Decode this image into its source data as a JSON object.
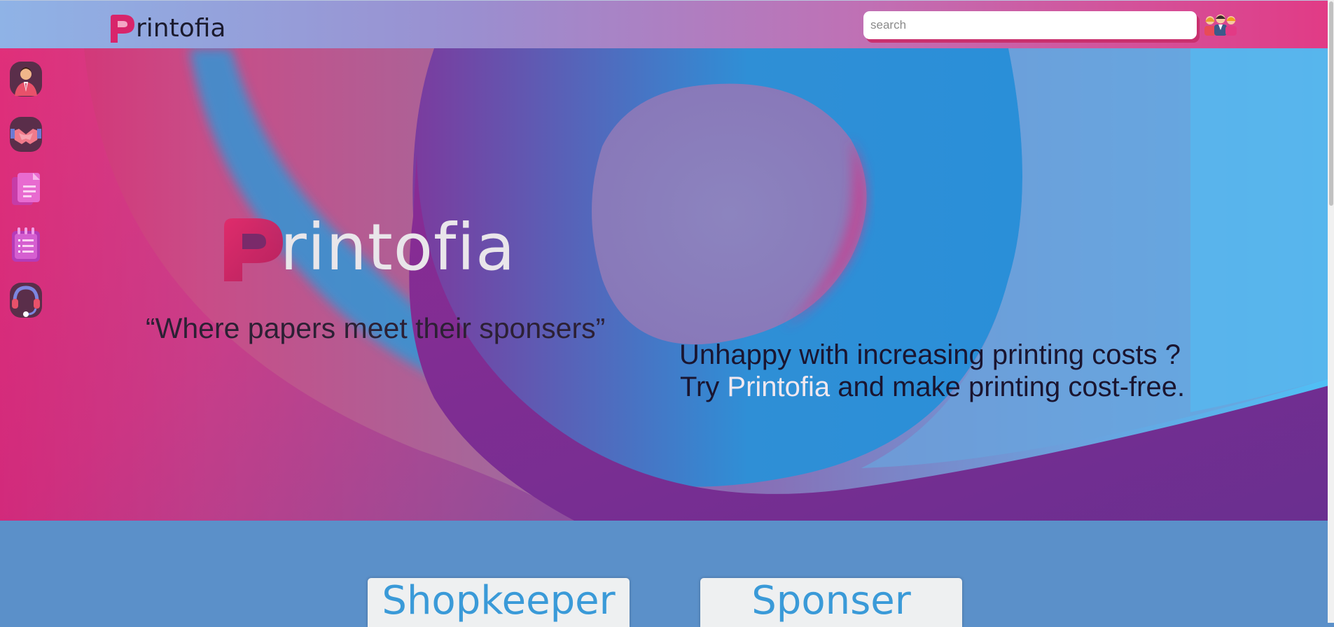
{
  "header": {
    "brand": "rintofia",
    "search_placeholder": "search"
  },
  "sidebar": {
    "items": [
      {
        "icon": "businessman-icon"
      },
      {
        "icon": "handshake-icon"
      },
      {
        "icon": "documents-icon"
      },
      {
        "icon": "notepad-list-icon"
      },
      {
        "icon": "headset-support-icon"
      }
    ]
  },
  "hero": {
    "brand": "rintofia",
    "tagline": "“Where papers meet their sponsers”",
    "pitch_line1": "Unhappy with increasing printing costs ?",
    "pitch_line2_pre": "Try ",
    "pitch_brand": "Printofia",
    "pitch_line2_post": " and make printing cost-free."
  },
  "cards": {
    "shopkeeper": "Shopkeeper",
    "sponser": "Sponser"
  },
  "colors": {
    "accent_pink": "#e0306f",
    "accent_blue": "#3a9ad8",
    "header_gradient": [
      "#8fb3e6",
      "#e23a85"
    ]
  }
}
